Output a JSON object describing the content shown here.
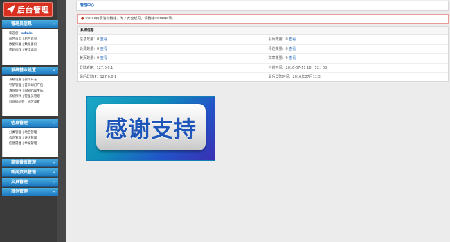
{
  "sidebar": {
    "logo_text": "后台管理",
    "sections": [
      {
        "title": "管理员信息",
        "arrow": "«",
        "lines": [
          "__welcome__",
          "前台首页 | 后台首页",
          "数据恢复 | 数据备份",
          "密码修改 | 安全退出"
        ],
        "welcome_label": "欢迎您：",
        "welcome_user": "admin"
      },
      {
        "title": "系统基本设置",
        "arrow": "«",
        "lines": [
          "系统设置 | 操作日志",
          "导航管理 | 首页幻灯广告",
          "清除缓存 | sitemap生成",
          "系统探针 | 管理员管理",
          "验证码问答 | 地区设置"
        ]
      },
      {
        "title": "信息管理",
        "arrow": "«",
        "lines": [
          "分类管理 | 地区管理",
          "信息管理 | 评论管理",
          "信息属性 | 举报管理"
        ]
      },
      {
        "title": "商家黄页管理",
        "arrow": "«"
      },
      {
        "title": "新闻资讯管理",
        "arrow": "«"
      },
      {
        "title": "文具管理",
        "arrow": "«"
      },
      {
        "title": "其他管理",
        "arrow": "«"
      }
    ]
  },
  "main": {
    "breadcrumb": "管理中心",
    "warning": "install目录没有删除。为了安全起见，请删除install目录。",
    "sysinfo": {
      "title": "系统信息",
      "rows": [
        {
          "left_label": "信息数量：",
          "left_value": "0",
          "left_link": "查看",
          "right_label": "投诉数量：",
          "right_value": "0",
          "right_link": "查看"
        },
        {
          "left_label": "会员数量：",
          "left_value": "0",
          "left_link": "查看",
          "right_label": "评论数量：",
          "right_value": "0",
          "right_link": "查看"
        },
        {
          "left_label": "黄页数量：",
          "left_value": "0",
          "left_link": "查看",
          "right_label": "文章数量：",
          "right_value": "0",
          "right_link": "查看"
        },
        {
          "left_label": "登陆者IP：",
          "left_value": "127.0.0.1",
          "left_link": "",
          "right_label": "当前时间：",
          "right_value": "2016-07-11 16：52：03",
          "right_link": ""
        },
        {
          "left_label": "最后登陆IP：",
          "left_value": "127.0.0.1",
          "left_link": "",
          "right_label": "最后登陆时间：",
          "right_value": "2016年07月11日",
          "right_link": ""
        }
      ]
    },
    "banner_text": "感谢支持"
  }
}
